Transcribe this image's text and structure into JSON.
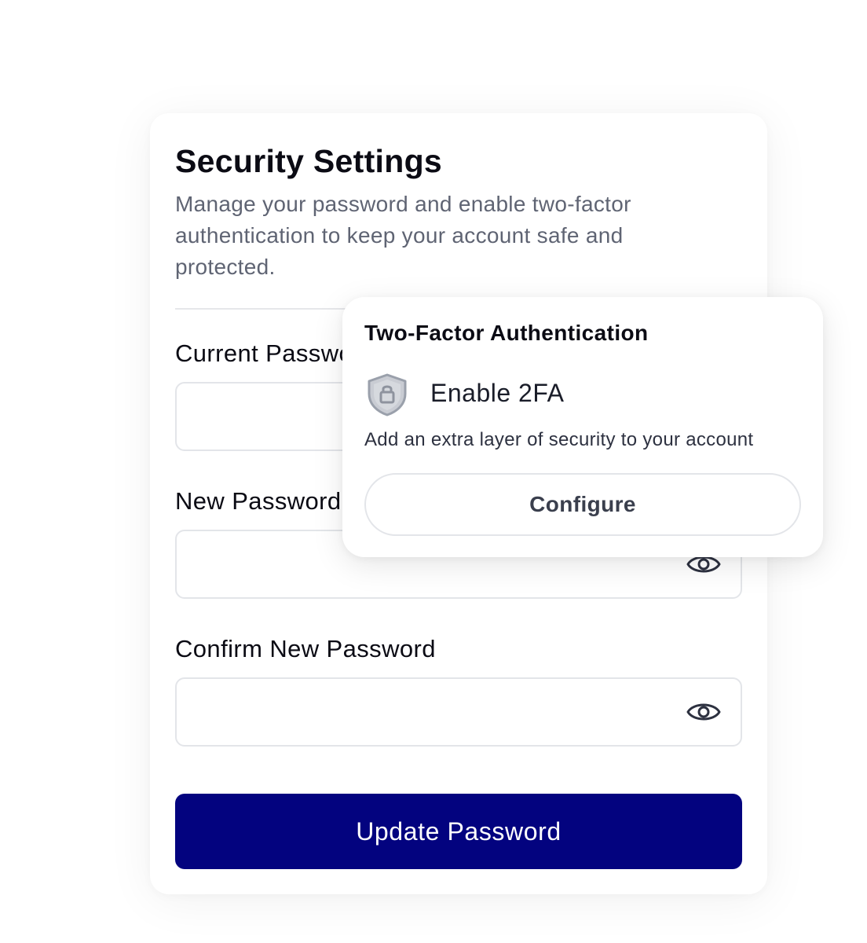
{
  "card": {
    "title": "Security Settings",
    "description": "Manage your password and enable two-factor authentication to keep your account safe and protected."
  },
  "fields": {
    "current_password": {
      "label": "Current Password",
      "value": ""
    },
    "new_password": {
      "label": "New Password",
      "value": ""
    },
    "confirm_password": {
      "label": "Confirm New Password",
      "value": ""
    }
  },
  "actions": {
    "update_label": "Update Password"
  },
  "two_factor": {
    "title": "Two-Factor Authentication",
    "enable_label": "Enable 2FA",
    "description": "Add an extra layer of security to your account",
    "configure_label": "Configure"
  },
  "icons": {
    "visibility": "eye-icon",
    "shield": "shield-lock-icon"
  },
  "colors": {
    "primary": "#03037f",
    "text": "#0b0b14",
    "muted": "#5f6473",
    "border": "#e3e5e9"
  }
}
